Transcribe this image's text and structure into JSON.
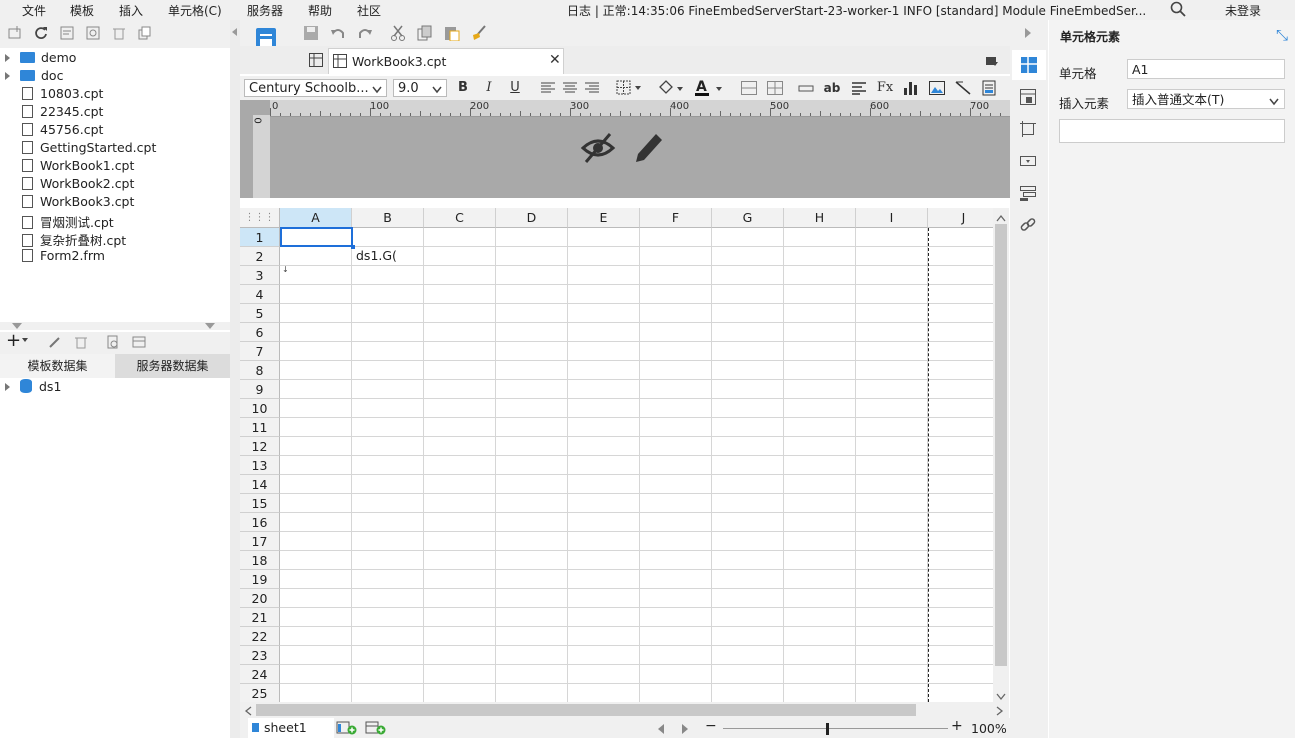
{
  "menubar": {
    "items": [
      "文件",
      "模板",
      "插入",
      "单元格(C)",
      "服务器",
      "帮助",
      "社区"
    ],
    "log": "日志 | 正常:14:35:06 FineEmbedServerStart-23-worker-1 INFO [standard] Module FineEmbedSer...",
    "login": "未登录"
  },
  "file_tree": [
    {
      "name": "demo",
      "type": "folder"
    },
    {
      "name": "doc",
      "type": "folder"
    },
    {
      "name": "10803.cpt",
      "type": "file"
    },
    {
      "name": "22345.cpt",
      "type": "file"
    },
    {
      "name": "45756.cpt",
      "type": "file"
    },
    {
      "name": "GettingStarted.cpt",
      "type": "file"
    },
    {
      "name": "WorkBook1.cpt",
      "type": "file"
    },
    {
      "name": "WorkBook2.cpt",
      "type": "file"
    },
    {
      "name": "WorkBook3.cpt",
      "type": "file"
    },
    {
      "name": "冒烟测试.cpt",
      "type": "file"
    },
    {
      "name": "复杂折叠树.cpt",
      "type": "file"
    },
    {
      "name": "Form2.frm",
      "type": "file"
    }
  ],
  "datasets": {
    "tabs": [
      "模板数据集",
      "服务器数据集"
    ],
    "items": [
      "ds1"
    ]
  },
  "tab": {
    "title": "WorkBook3.cpt"
  },
  "format": {
    "font": "Century Schoolb...",
    "size": "9.0"
  },
  "ruler_labels": [
    "0",
    "100",
    "200",
    "300",
    "400",
    "500",
    "600",
    "700"
  ],
  "ruler_vertical": "0",
  "grid": {
    "columns": [
      "A",
      "B",
      "C",
      "D",
      "E",
      "F",
      "G",
      "H",
      "I",
      "J"
    ],
    "rows": [
      "1",
      "2",
      "3",
      "4",
      "5",
      "6",
      "7",
      "8",
      "9",
      "10",
      "11",
      "12",
      "13",
      "14",
      "15",
      "16",
      "17",
      "18",
      "19",
      "20",
      "21",
      "22",
      "23",
      "24",
      "25"
    ],
    "cell_B2": "ds1.G("
  },
  "status": {
    "sheet": "sheet1",
    "zoom": "100%"
  },
  "properties": {
    "title": "单元格元素",
    "cell_label": "单元格",
    "cell_value": "A1",
    "insert_label": "插入元素",
    "insert_value": "插入普通文本(T)"
  },
  "colors": {
    "accent": "#2f86d8",
    "selection": "#1e6fd9"
  }
}
